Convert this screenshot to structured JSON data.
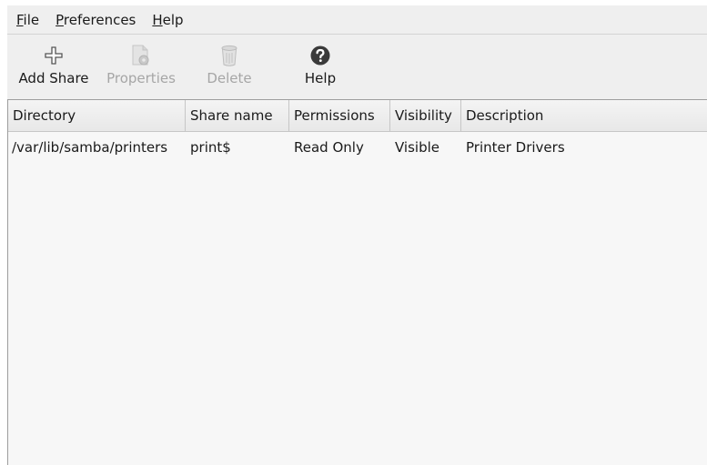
{
  "menubar": {
    "items": [
      {
        "mnemonic": "F",
        "rest": "ile"
      },
      {
        "mnemonic": "P",
        "rest": "references"
      },
      {
        "mnemonic": "H",
        "rest": "elp"
      }
    ]
  },
  "toolbar": {
    "add_label": "Add Share",
    "properties_label": "Properties",
    "delete_label": "Delete",
    "help_label": "Help"
  },
  "table": {
    "headers": [
      "Directory",
      "Share name",
      "Permissions",
      "Visibility",
      "Description"
    ],
    "rows": [
      [
        "/var/lib/samba/printers",
        "print$",
        "Read Only",
        "Visible",
        "Printer Drivers"
      ]
    ]
  },
  "icons": {
    "add": "plus-icon",
    "properties": "properties-icon",
    "delete": "trash-icon",
    "help": "help-icon"
  }
}
